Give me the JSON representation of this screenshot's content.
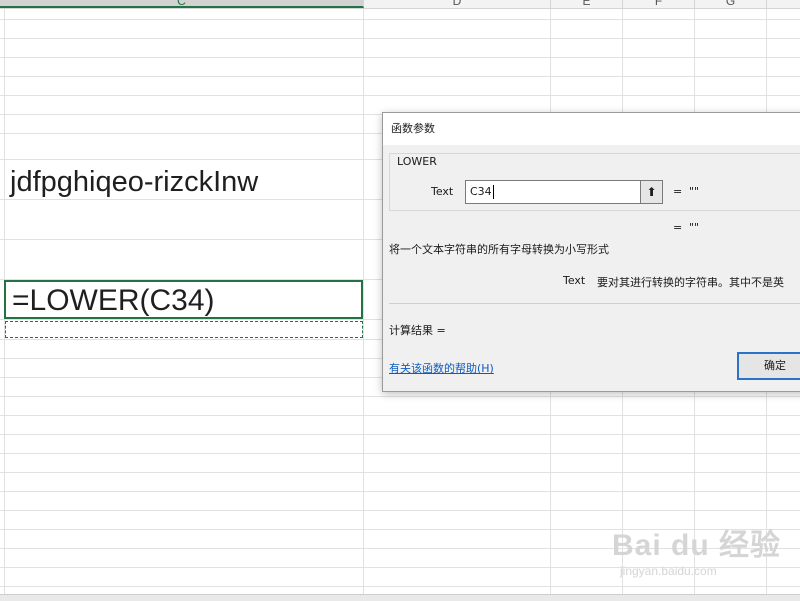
{
  "columns": [
    "C",
    "D",
    "E",
    "F",
    "G"
  ],
  "cells": {
    "c_text": "jdfpghiqeo-rizckInw",
    "c_formula": "=LOWER(C34)"
  },
  "dialog": {
    "title": "函数参数",
    "function_name": "LOWER",
    "arg_label": "Text",
    "arg_value": "C34",
    "eq1": "=",
    "val1": "\"\"",
    "eq2": "=",
    "val2": "\"\"",
    "description": "将一个文本字符串的所有字母转换为小写形式",
    "arg_desc_name": "Text",
    "arg_desc_text": "要对其进行转换的字符串。其中不是英",
    "result_label": "计算结果 =",
    "help_link": "有关该函数的帮助(H)",
    "ok_label": "确定"
  },
  "watermark": {
    "main": "Bai du 经验",
    "sub": "jingyan.baidu.com"
  }
}
